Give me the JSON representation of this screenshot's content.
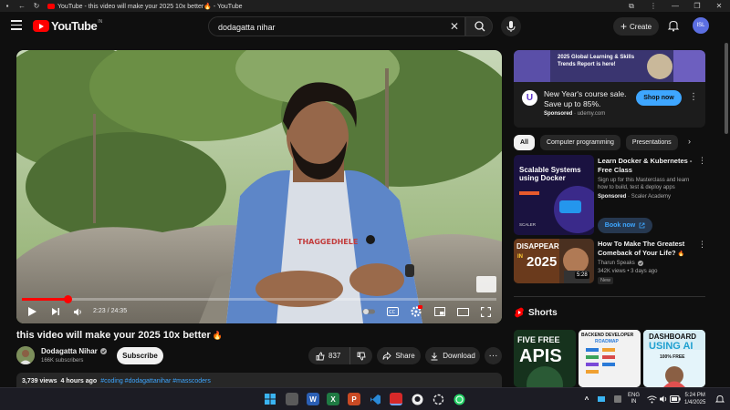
{
  "browser": {
    "tab_title": "YouTube - this video will make your 2025 10x better🔥 - YouTube"
  },
  "masthead": {
    "logo_text": "YouTube",
    "country_code": "IN",
    "search_value": "dodagatta nihar",
    "search_placeholder": "Search",
    "create_label": "Create",
    "avatar_initials": "ISL"
  },
  "player": {
    "current_time": "2:23",
    "separator": "/",
    "duration": "24:35",
    "progress": 0.097,
    "shirt_text": "THAGGEDHELE"
  },
  "video": {
    "title": "this video will make your 2025 10x better",
    "title_emoji": "🔥",
    "channel_name": "Dodagatta Nihar",
    "subscribers": "166K subscribers",
    "subscribe_label": "Subscribe",
    "like_count": "837",
    "share_label": "Share",
    "download_label": "Download",
    "views": "3,739 views",
    "posted": "4 hours ago",
    "tags": "#coding #dodagattanihar #masscoders"
  },
  "ad": {
    "banner_text": "2025 Global Learning & Skills Trends Report is here!",
    "logo_letter": "U",
    "text": "New Year's course sale. Save up to 85%.",
    "sponsored_label": "Sponsored",
    "domain": "udemy.com",
    "cta": "Shop now"
  },
  "chips": [
    "All",
    "Computer programming",
    "Presentations"
  ],
  "recommendations": [
    {
      "title": "Learn Docker & Kubernetes - Free Class",
      "description": "Sign up for this Masterclass and learn how to build, test & deploy apps",
      "sponsored_label": "Sponsored",
      "channel": "Scaler Academy",
      "cta": "Book now",
      "thumb_subtitle": "Scalable Systems using Docker",
      "thumb_brand": "SCALER"
    },
    {
      "title": "How To Make The Greatest Comeback of Your Life?",
      "title_emoji": "🔥",
      "channel": "Tharun Speaks",
      "views": "342K views",
      "posted": "3 days ago",
      "badge": "New",
      "duration": "5:28",
      "thumb_text_top": "DISAPPEAR",
      "thumb_text_bottom": "2025",
      "thumb_in": "IN"
    }
  ],
  "shorts": {
    "header": "Shorts",
    "items": [
      {
        "line1": "FIVE FREE",
        "line2": "APIS"
      },
      {
        "line1": "BACKEND DEVELOPER",
        "line2": "ROADMAP"
      },
      {
        "line1": "DASHBOARD",
        "line2": "USING AI",
        "line3": "100% FREE"
      }
    ]
  },
  "taskbar": {
    "lang_top": "ENG",
    "lang_bottom": "IN",
    "time": "5:24 PM",
    "date": "1/4/2025"
  },
  "colors": {
    "background": "#0f0f0f",
    "brand_red": "#ff0000",
    "link_blue": "#3ea6ff",
    "surface": "#272727"
  }
}
